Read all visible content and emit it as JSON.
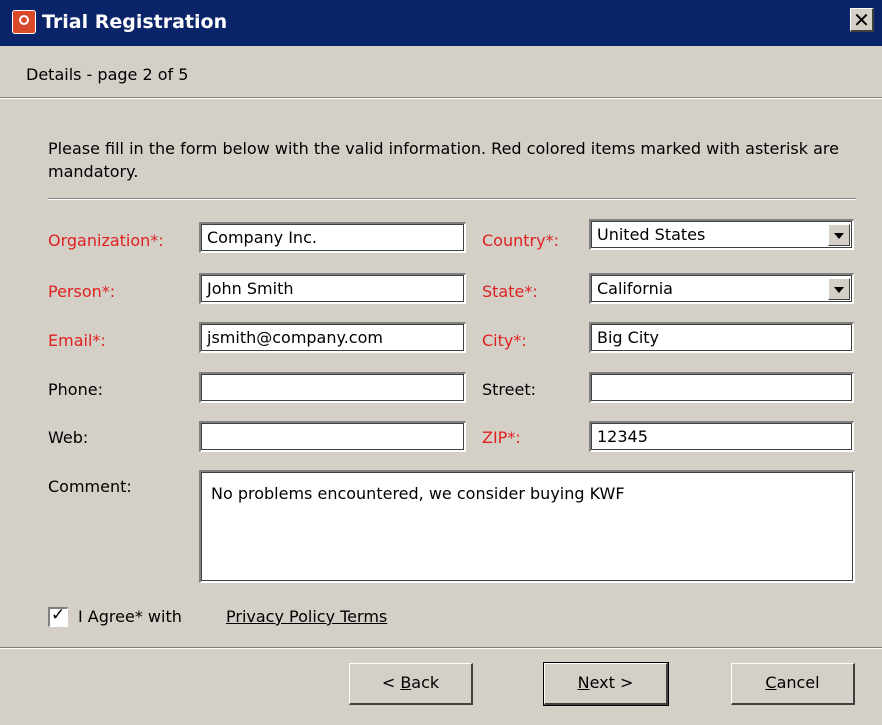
{
  "window": {
    "title": "Trial Registration",
    "close_glyph": "✕",
    "app_icon": "app-logo-icon"
  },
  "page": {
    "heading": "Details - page 2 of 5",
    "instructions": "Please fill in the form below with the valid information. Red colored items marked with asterisk are mandatory."
  },
  "colors": {
    "title_bar": "#0a246a",
    "required_label": "#e02020",
    "face": "#d4d0c8"
  },
  "form": {
    "organization": {
      "label": "Organization*:",
      "value": "Company Inc."
    },
    "person": {
      "label": "Person*:",
      "value": "John Smith"
    },
    "email": {
      "label": "Email*:",
      "value": "jsmith@company.com"
    },
    "phone": {
      "label": "Phone:",
      "value": ""
    },
    "web": {
      "label": "Web:",
      "value": ""
    },
    "country": {
      "label": "Country*:",
      "value": "United States"
    },
    "state": {
      "label": "State*:",
      "value": "California"
    },
    "city": {
      "label": "City*:",
      "value": "Big City"
    },
    "street": {
      "label": "Street:",
      "value": ""
    },
    "zip": {
      "label": "ZIP*:",
      "value": "12345"
    },
    "comment": {
      "label": "Comment:",
      "value": "No problems encountered, we consider buying KWF"
    }
  },
  "agree": {
    "checked": true,
    "check_glyph": "✓",
    "label": "I Agree* with",
    "link": "Privacy Policy Terms"
  },
  "buttons": {
    "back": {
      "prefix": "< ",
      "mnemonic": "B",
      "rest": "ack"
    },
    "next": {
      "mnemonic": "N",
      "rest": "ext >"
    },
    "cancel": {
      "mnemonic": "C",
      "rest": "ancel"
    }
  }
}
